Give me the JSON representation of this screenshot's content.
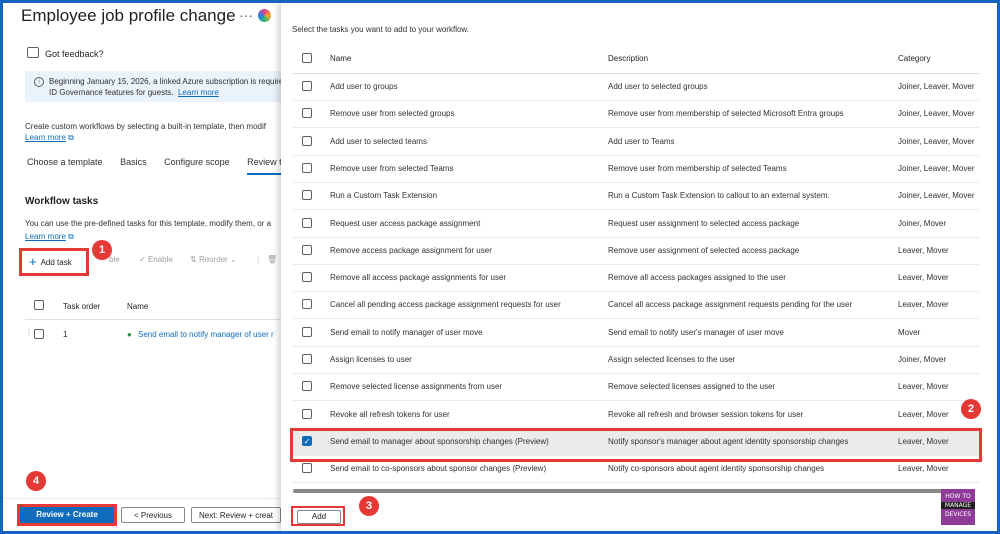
{
  "left": {
    "title": "Employee job profile change",
    "more": "···",
    "feedback": "Got feedback?",
    "info": {
      "line1": "Beginning January 15, 2026, a linked Azure subscription is required t",
      "line2": "ID Governance features for guests.",
      "link": "Learn more"
    },
    "description": {
      "line1": "Create custom workflows by selecting a built-in template, then modif",
      "link": "Learn more"
    },
    "tabs": [
      "Choose a template",
      "Basics",
      "Configure scope",
      "Review tas"
    ],
    "workflow_tasks": {
      "title": "Workflow tasks",
      "desc": "You can use the pre-defined tasks for this template, modify them, or a",
      "link": "Learn more"
    },
    "toolbar": {
      "add_task": "Add task",
      "disable": "ble",
      "enable": "Enable",
      "reorder": "Reorder"
    },
    "table": {
      "headers": [
        "Task order",
        "Name"
      ],
      "rows": [
        {
          "order": "1",
          "name": "Send email to notify manager of user r"
        }
      ]
    },
    "footer": {
      "review_create": "Review + Create",
      "previous": "< Previous",
      "next": "Next: Review + creat"
    }
  },
  "right": {
    "heading": "Select the tasks you want to add to your workflow.",
    "columns": [
      "Name",
      "Description",
      "Category"
    ],
    "rows": [
      {
        "name": "Add user to groups",
        "description": "Add user to selected groups",
        "category": "Joiner, Leaver, Mover",
        "checked": false
      },
      {
        "name": "Remove user from selected groups",
        "description": "Remove user from membership of selected Microsoft Entra groups",
        "category": "Joiner, Leaver, Mover",
        "checked": false
      },
      {
        "name": "Add user to selected teams",
        "description": "Add user to Teams",
        "category": "Joiner, Leaver, Mover",
        "checked": false
      },
      {
        "name": "Remove user from selected Teams",
        "description": "Remove user from membership of selected Teams",
        "category": "Joiner, Leaver, Mover",
        "checked": false
      },
      {
        "name": "Run a Custom Task Extension",
        "description": "Run a Custom Task Extension to callout to an external system.",
        "category": "Joiner, Leaver, Mover",
        "checked": false
      },
      {
        "name": "Request user access package assignment",
        "description": "Request user assignment to selected access package",
        "category": "Joiner, Mover",
        "checked": false
      },
      {
        "name": "Remove access package assignment for user",
        "description": "Remove user assignment of selected access package",
        "category": "Leaver, Mover",
        "checked": false
      },
      {
        "name": "Remove all access package assignments for user",
        "description": "Remove all access packages assigned to the user",
        "category": "Leaver, Mover",
        "checked": false
      },
      {
        "name": "Cancel all pending access package assignment requests for user",
        "description": "Cancel all access package assignment requests pending for the user",
        "category": "Leaver, Mover",
        "checked": false
      },
      {
        "name": "Send email to notify manager of user move",
        "description": "Send email to notify user's manager of user move",
        "category": "Mover",
        "checked": false
      },
      {
        "name": "Assign licenses to user",
        "description": "Assign selected licenses to the user",
        "category": "Joiner, Mover",
        "checked": false
      },
      {
        "name": "Remove selected license assignments from user",
        "description": "Remove selected licenses assigned to the user",
        "category": "Leaver, Mover",
        "checked": false
      },
      {
        "name": "Revoke all refresh tokens for user",
        "description": "Revoke all refresh and browser session tokens for user",
        "category": "Leaver, Mover",
        "checked": false
      },
      {
        "name": "Send email to manager about sponsorship changes (Preview)",
        "description": "Notify sponsor's manager about agent identity sponsorship changes",
        "category": "Leaver, Mover",
        "checked": true
      },
      {
        "name": "Send email to co-sponsors about sponsor changes (Preview)",
        "description": "Notify co-sponsors about agent identity sponsorship changes",
        "category": "Leaver, Mover",
        "checked": false
      }
    ],
    "add_button": "Add"
  },
  "badges": [
    "1",
    "2",
    "3",
    "4"
  ],
  "logo": {
    "line1": "HOW TO",
    "line2": "MANAGE",
    "line3": "DEVICES"
  },
  "colors": {
    "accent": "#0f6cbd",
    "highlight": "#e53935",
    "frame": "#1565c0"
  }
}
